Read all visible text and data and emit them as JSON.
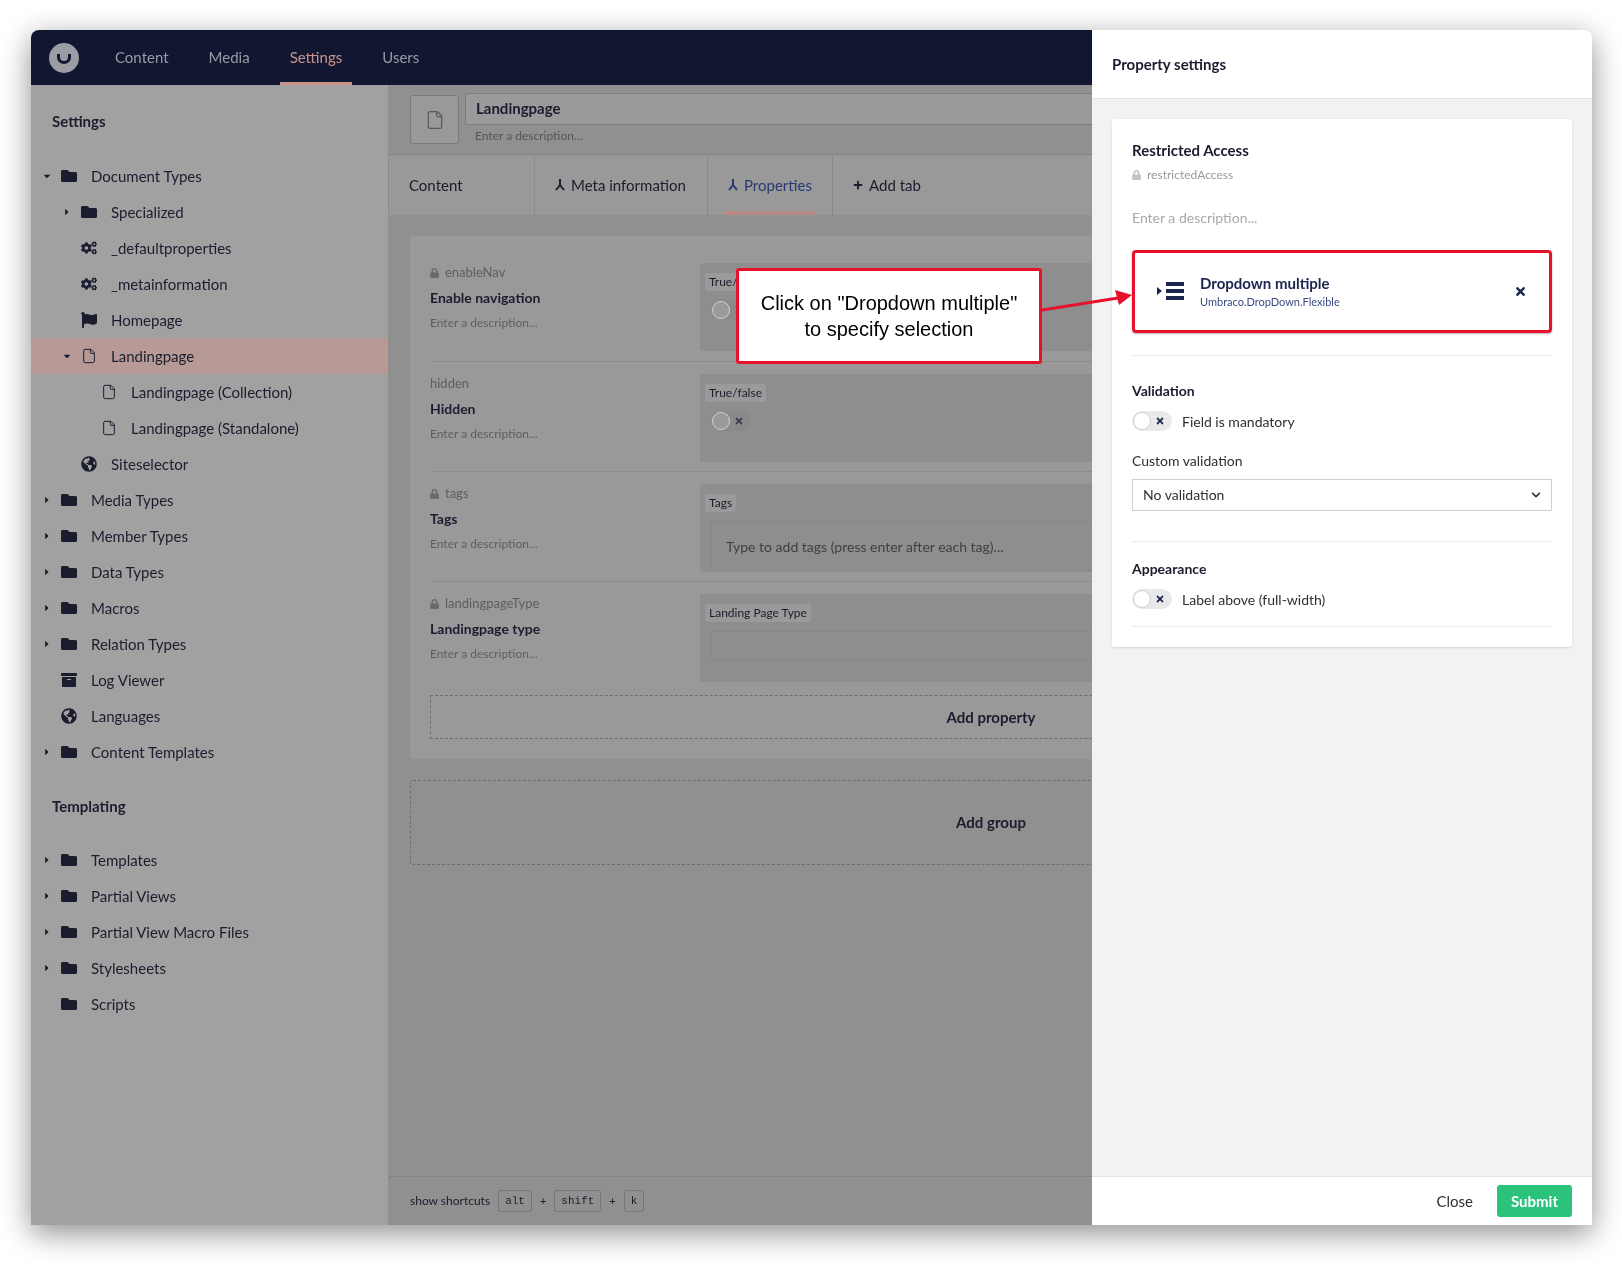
{
  "topnav": {
    "items": [
      {
        "label": "Content",
        "selected": false
      },
      {
        "label": "Media",
        "selected": false
      },
      {
        "label": "Settings",
        "selected": true
      },
      {
        "label": "Users",
        "selected": false
      }
    ]
  },
  "sidebar": {
    "title": "Settings",
    "sections": [
      {
        "items": [
          {
            "label": "Document Types",
            "kind": "folder",
            "expanded": true,
            "selected": false,
            "children": [
              {
                "label": "Specialized",
                "kind": "folder",
                "expanded": false,
                "selected": false
              },
              {
                "label": "_defaultproperties",
                "kind": "gears",
                "selected": false
              },
              {
                "label": "_metainformation",
                "kind": "gears",
                "selected": false
              },
              {
                "label": "Homepage",
                "kind": "flag",
                "selected": false
              },
              {
                "label": "Landingpage",
                "kind": "document",
                "expanded": true,
                "selected": true,
                "children": [
                  {
                    "label": "Landingpage (Collection)",
                    "kind": "document",
                    "selected": false
                  },
                  {
                    "label": "Landingpage (Standalone)",
                    "kind": "document",
                    "selected": false
                  }
                ]
              },
              {
                "label": "Siteselector",
                "kind": "globe",
                "selected": false
              }
            ]
          },
          {
            "label": "Media Types",
            "kind": "folder",
            "expanded": false,
            "selected": false
          },
          {
            "label": "Member Types",
            "kind": "folder",
            "expanded": false,
            "selected": false
          },
          {
            "label": "Data Types",
            "kind": "folder",
            "expanded": false,
            "selected": false
          },
          {
            "label": "Macros",
            "kind": "folder",
            "expanded": false,
            "selected": false
          },
          {
            "label": "Relation Types",
            "kind": "folder",
            "expanded": false,
            "selected": false
          },
          {
            "label": "Log Viewer",
            "kind": "archive",
            "selected": false
          },
          {
            "label": "Languages",
            "kind": "globe",
            "selected": false
          },
          {
            "label": "Content Templates",
            "kind": "folder",
            "expanded": false,
            "selected": false
          }
        ]
      },
      {
        "title": "Templating",
        "items": [
          {
            "label": "Templates",
            "kind": "folder",
            "expanded": false,
            "selected": false
          },
          {
            "label": "Partial Views",
            "kind": "folder",
            "expanded": false,
            "selected": false
          },
          {
            "label": "Partial View Macro Files",
            "kind": "folder",
            "expanded": false,
            "selected": false
          },
          {
            "label": "Stylesheets",
            "kind": "folder",
            "expanded": false,
            "selected": false
          },
          {
            "label": "Scripts",
            "kind": "folder",
            "selected": false
          }
        ]
      }
    ]
  },
  "editor": {
    "name": "Landingpage",
    "description_placeholder": "Enter a description...",
    "tabs": [
      {
        "label": "Content",
        "kind": "plain",
        "selected": false
      },
      {
        "label": "Meta information",
        "kind": "group",
        "selected": false
      },
      {
        "label": "Properties",
        "kind": "group",
        "selected": true
      },
      {
        "label": "Add tab",
        "kind": "add",
        "selected": false
      }
    ],
    "properties": [
      {
        "alias": "enableNav",
        "locked": true,
        "name": "Enable navigation",
        "description_placeholder": "Enter a description...",
        "editor_label": "True/",
        "kind": "toggle",
        "on": false
      },
      {
        "alias": "hidden",
        "locked": false,
        "name": "Hidden",
        "description_placeholder": "Enter a description...",
        "editor_label": "True/false",
        "kind": "toggle",
        "on": false
      },
      {
        "alias": "tags",
        "locked": true,
        "name": "Tags",
        "description_placeholder": "Enter a description...",
        "editor_label": "Tags",
        "kind": "tags",
        "placeholder": "Type to add tags (press enter after each tag)..."
      },
      {
        "alias": "landingpageType",
        "locked": true,
        "name": "Landingpage type",
        "description_placeholder": "Enter a description...",
        "editor_label": "Landing Page Type",
        "kind": "input"
      }
    ],
    "add_property": "Add property",
    "add_group": "Add group",
    "shortcuts": {
      "label": "show shortcuts",
      "parts": [
        {
          "kind": "key",
          "text": "alt"
        },
        {
          "kind": "sep",
          "text": "+"
        },
        {
          "kind": "key",
          "text": "shift"
        },
        {
          "kind": "sep",
          "text": "+"
        },
        {
          "kind": "key",
          "text": "k"
        }
      ]
    }
  },
  "callout": {
    "text": "Click on \"Dropdown multiple\" to specify selection"
  },
  "panel": {
    "title": "Property settings",
    "name": "Restricted Access",
    "alias": "restrictedAccess",
    "alias_locked": true,
    "description_placeholder": "Enter a description...",
    "property_editor": {
      "name": "Dropdown multiple",
      "alias": "Umbraco.DropDown.Flexible"
    },
    "validation": {
      "title": "Validation",
      "mandatory": {
        "label": "Field is mandatory",
        "on": false
      },
      "custom_label": "Custom validation",
      "custom_value": "No validation"
    },
    "appearance": {
      "title": "Appearance",
      "label_above": {
        "label": "Label above (full-width)",
        "on": false
      }
    },
    "buttons": {
      "close": "Close",
      "submit": "Submit"
    }
  }
}
